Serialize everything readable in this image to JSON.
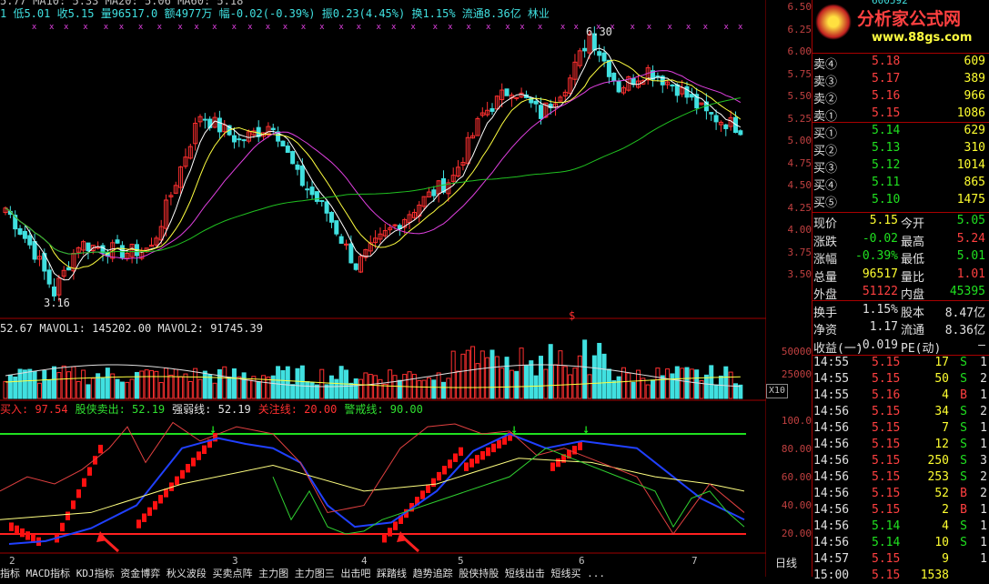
{
  "header": {
    "info_line": "1 低5.01 收5.15 量96517.0 额4977万 幅-0.02(-0.39%) 振0.23(4.45%) 换1.15% 流通8.36亿 林业",
    "top_partial": "5.77  MA10: 5.33  MA20: 5.06  MA60: 5.18",
    "high_mark": "6.30",
    "low_mark": "3.16",
    "dollar_mark": "$"
  },
  "price_axis": [
    "6.50",
    "6.25",
    "6.00",
    "5.75",
    "5.50",
    "5.25",
    "5.00",
    "4.75",
    "4.50",
    "4.25",
    "4.00",
    "3.75",
    "3.50"
  ],
  "volume": {
    "header": "52.67  MAVOL1: 145202.00  MAVOL2: 91745.39",
    "axis": [
      "50000",
      "25000"
    ],
    "unit": "X10"
  },
  "indicator": {
    "labels": [
      {
        "text": "买入: 97.54",
        "color": "#ff3030"
      },
      {
        "text": "股侠卖出: 52.19",
        "color": "#30e030"
      },
      {
        "text": "强弱线: 52.19",
        "color": "#e0e0e0"
      },
      {
        "text": "关注线: 20.00",
        "color": "#ff3030"
      },
      {
        "text": "警戒线: 90.00",
        "color": "#30e030"
      }
    ],
    "axis": [
      "100.0",
      "80.00",
      "60.00",
      "40.00",
      "20.00"
    ]
  },
  "xaxis": [
    "2",
    "3",
    "4",
    "5",
    "6",
    "7"
  ],
  "period_label": "日线",
  "bottom_tabs": "指标  MACD指标  KDJ指标  资金博弈  秋义波段  买卖点阵  主力图  主力图三  出击吧  踩踏线  趋势追踪  股侠持股  短线出击  短线买  ...",
  "logo": {
    "title": "分析家公式网",
    "url": "www.88gs.com",
    "stock_code": "600592"
  },
  "order_book": {
    "sells": [
      {
        "label": "卖④",
        "price": "5.18",
        "vol": "609"
      },
      {
        "label": "卖③",
        "price": "5.17",
        "vol": "389"
      },
      {
        "label": "卖②",
        "price": "5.16",
        "vol": "966"
      },
      {
        "label": "卖①",
        "price": "5.15",
        "vol": "1086"
      }
    ],
    "buys": [
      {
        "label": "买①",
        "price": "5.14",
        "vol": "629"
      },
      {
        "label": "买②",
        "price": "5.13",
        "vol": "310"
      },
      {
        "label": "买③",
        "price": "5.12",
        "vol": "1014"
      },
      {
        "label": "买④",
        "price": "5.11",
        "vol": "865"
      },
      {
        "label": "买⑤",
        "price": "5.10",
        "vol": "1475"
      }
    ]
  },
  "quote": [
    {
      "l1": "现价",
      "v1": "5.15",
      "c1": "#ffff30",
      "l2": "今开",
      "v2": "5.05",
      "c2": "#20e020"
    },
    {
      "l1": "涨跌",
      "v1": "-0.02",
      "c1": "#20e020",
      "l2": "最高",
      "v2": "5.24",
      "c2": "#ff4040"
    },
    {
      "l1": "涨幅",
      "v1": "-0.39%",
      "c1": "#20e020",
      "l2": "最低",
      "v2": "5.01",
      "c2": "#20e020"
    },
    {
      "l1": "总量",
      "v1": "96517",
      "c1": "#ffff30",
      "l2": "量比",
      "v2": "1.01",
      "c2": "#ff4040"
    },
    {
      "l1": "外盘",
      "v1": "51122",
      "c1": "#ff4040",
      "l2": "内盘",
      "v2": "45395",
      "c2": "#20e020"
    },
    {
      "l1": "换手",
      "v1": "1.15%",
      "c1": "#e0e0e0",
      "l2": "股本",
      "v2": "8.47亿",
      "c2": "#e0e0e0"
    },
    {
      "l1": "净资",
      "v1": "1.17",
      "c1": "#e0e0e0",
      "l2": "流通",
      "v2": "8.36亿",
      "c2": "#e0e0e0"
    },
    {
      "l1": "收益(一)",
      "v1": "-0.019",
      "c1": "#e0e0e0",
      "l2": "PE(动)",
      "v2": "—",
      "c2": "#e0e0e0"
    }
  ],
  "ticks": [
    {
      "time": "14:55",
      "price": "5.15",
      "vol": "17",
      "bs": "S",
      "n": "1"
    },
    {
      "time": "14:55",
      "price": "5.15",
      "vol": "50",
      "bs": "S",
      "n": "2"
    },
    {
      "time": "14:55",
      "price": "5.16",
      "vol": "4",
      "bs": "B",
      "n": "1"
    },
    {
      "time": "14:56",
      "price": "5.15",
      "vol": "34",
      "bs": "S",
      "n": "2"
    },
    {
      "time": "14:56",
      "price": "5.15",
      "vol": "7",
      "bs": "S",
      "n": "1"
    },
    {
      "time": "14:56",
      "price": "5.15",
      "vol": "12",
      "bs": "S",
      "n": "1"
    },
    {
      "time": "14:56",
      "price": "5.15",
      "vol": "250",
      "bs": "S",
      "n": "3"
    },
    {
      "time": "14:56",
      "price": "5.15",
      "vol": "253",
      "bs": "S",
      "n": "2"
    },
    {
      "time": "14:56",
      "price": "5.15",
      "vol": "52",
      "bs": "B",
      "n": "2"
    },
    {
      "time": "14:56",
      "price": "5.15",
      "vol": "2",
      "bs": "B",
      "n": "1"
    },
    {
      "time": "14:56",
      "price": "5.14",
      "vol": "4",
      "bs": "S",
      "n": "1"
    },
    {
      "time": "14:56",
      "price": "5.14",
      "vol": "10",
      "bs": "S",
      "n": "1"
    },
    {
      "time": "14:57",
      "price": "5.15",
      "vol": "9",
      "bs": "",
      "n": "1"
    },
    {
      "time": "15:00",
      "price": "5.15",
      "vol": "1538",
      "bs": "",
      "n": ""
    }
  ],
  "colors": {
    "up": "#ff3030",
    "down": "#40e0e0",
    "grid": "#a00000",
    "ma5": "#ffffff",
    "ma10": "#ffff40",
    "ma20": "#e040e0",
    "ma60": "#20c020"
  }
}
